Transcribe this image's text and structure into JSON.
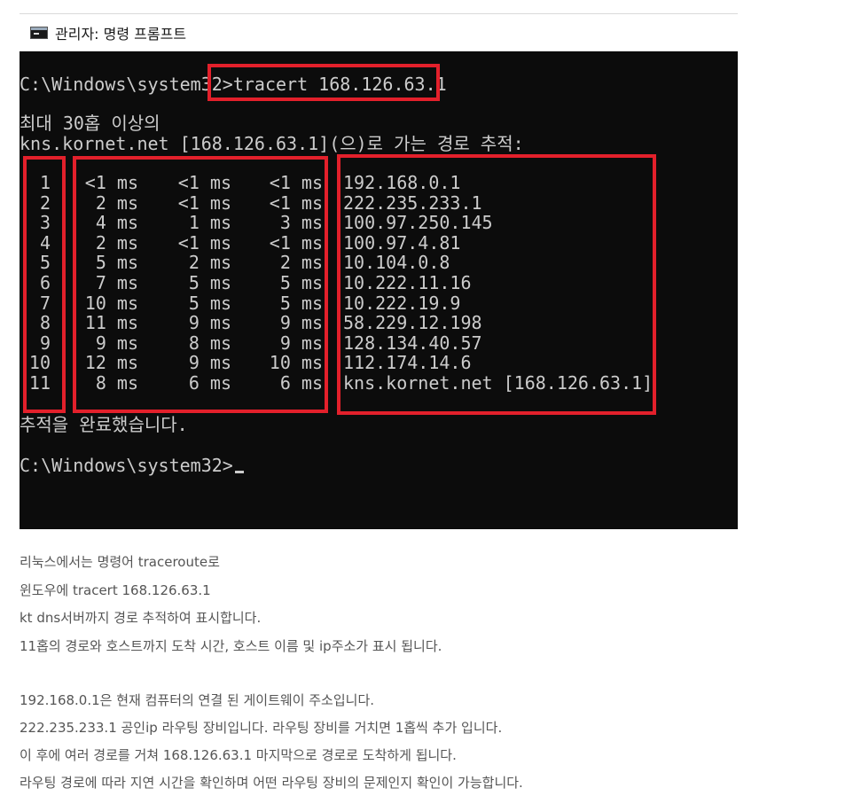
{
  "window": {
    "title": "관리자: 명령 프롬프트"
  },
  "console": {
    "prompt1": "C:\\Windows\\system32>",
    "command": "tracert 168.126.63.1",
    "header1": "최대 30홉 이상의",
    "header2": "kns.kornet.net [168.126.63.1](으)로 가는 경로 추적:",
    "hops": [
      {
        "n": "1",
        "t1": "<1 ms",
        "t2": "<1 ms",
        "t3": "<1 ms",
        "host": "192.168.0.1"
      },
      {
        "n": "2",
        "t1": "2 ms",
        "t2": "<1 ms",
        "t3": "<1 ms",
        "host": "222.235.233.1"
      },
      {
        "n": "3",
        "t1": "4 ms",
        "t2": "1 ms",
        "t3": "3 ms",
        "host": "100.97.250.145"
      },
      {
        "n": "4",
        "t1": "2 ms",
        "t2": "<1 ms",
        "t3": "<1 ms",
        "host": "100.97.4.81"
      },
      {
        "n": "5",
        "t1": "5 ms",
        "t2": "2 ms",
        "t3": "2 ms",
        "host": "10.104.0.8"
      },
      {
        "n": "6",
        "t1": "7 ms",
        "t2": "5 ms",
        "t3": "5 ms",
        "host": "10.222.11.16"
      },
      {
        "n": "7",
        "t1": "10 ms",
        "t2": "5 ms",
        "t3": "5 ms",
        "host": "10.222.19.9"
      },
      {
        "n": "8",
        "t1": "11 ms",
        "t2": "9 ms",
        "t3": "9 ms",
        "host": "58.229.12.198"
      },
      {
        "n": "9",
        "t1": "9 ms",
        "t2": "8 ms",
        "t3": "9 ms",
        "host": "128.134.40.57"
      },
      {
        "n": "10",
        "t1": "12 ms",
        "t2": "9 ms",
        "t3": "10 ms",
        "host": "112.174.14.6"
      },
      {
        "n": "11",
        "t1": "8 ms",
        "t2": "6 ms",
        "t3": "6 ms",
        "host": "kns.kornet.net [168.126.63.1]"
      }
    ],
    "complete": "추적을 완료했습니다.",
    "prompt2": "C:\\Windows\\system32>"
  },
  "description": {
    "lines": [
      "리눅스에서는 명령어 traceroute로",
      "윈도우에 tracert 168.126.63.1",
      "kt dns서버까지 경로 추적하여 표시합니다.",
      "11홉의 경로와 호스트까지 도착 시간, 호스트 이름 및 ip주소가 표시 됩니다.",
      "192.168.0.1은 현재 컴퓨터의 연결 된 게이트웨이 주소입니다.",
      "222.235.233.1 공인ip 라우팅 장비입니다. 라우팅 장비를 거치면 1홉씩 추가 입니다.",
      "이 후에 여러 경로를 거쳐 168.126.63.1 마지막으로 경로로 도착하게 됩니다.",
      "라우팅 경로에 따라 지연 시간을 확인하며 어떤 라우팅 장비의 문제인지 확인이 가능합니다."
    ]
  },
  "colors": {
    "console_bg": "#0c0c0c",
    "console_text": "#cccccc",
    "highlight_box": "#e3202b",
    "desc_text": "#555555"
  }
}
